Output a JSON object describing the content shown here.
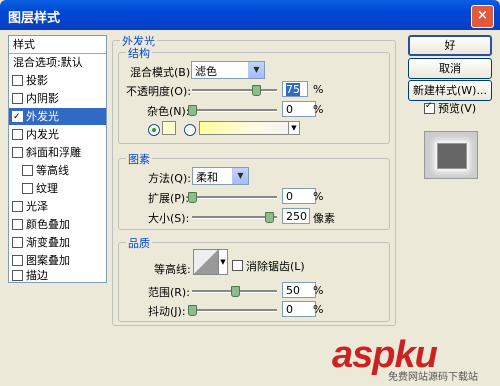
{
  "window": {
    "title": "图层样式",
    "close_label": "×"
  },
  "left_panel": {
    "header": "样式",
    "items": [
      {
        "label": "混合选项:默认",
        "checkbox": false,
        "checked": false,
        "selected": false
      },
      {
        "label": "投影",
        "checkbox": true,
        "checked": false,
        "selected": false
      },
      {
        "label": "内阴影",
        "checkbox": true,
        "checked": false,
        "selected": false
      },
      {
        "label": "外发光",
        "checkbox": true,
        "checked": true,
        "selected": true
      },
      {
        "label": "内发光",
        "checkbox": true,
        "checked": false,
        "selected": false
      },
      {
        "label": "斜面和浮雕",
        "checkbox": true,
        "checked": false,
        "selected": false
      },
      {
        "label": "等高线",
        "checkbox": true,
        "checked": false,
        "selected": false,
        "indent": true
      },
      {
        "label": "纹理",
        "checkbox": true,
        "checked": false,
        "selected": false,
        "indent": true
      },
      {
        "label": "光泽",
        "checkbox": true,
        "checked": false,
        "selected": false
      },
      {
        "label": "颜色叠加",
        "checkbox": true,
        "checked": false,
        "selected": false
      },
      {
        "label": "渐变叠加",
        "checkbox": true,
        "checked": false,
        "selected": false
      },
      {
        "label": "图案叠加",
        "checkbox": true,
        "checked": false,
        "selected": false
      },
      {
        "label": "描边",
        "checkbox": true,
        "checked": false,
        "selected": false
      }
    ]
  },
  "outer_glow": {
    "title": "外发光",
    "structure": {
      "title": "结构",
      "blend_mode_label": "混合模式(B):",
      "blend_mode_value": "滤色",
      "opacity_label": "不透明度(O):",
      "opacity_value": "75",
      "opacity_unit": "%",
      "opacity_level": 0.75,
      "noise_label": "杂色(N):",
      "noise_value": "0",
      "noise_unit": "%",
      "noise_level": 0
    },
    "elements": {
      "title": "图素",
      "technique_label": "方法(Q):",
      "technique_value": "柔和",
      "spread_label": "扩展(P):",
      "spread_value": "0",
      "spread_unit": "%",
      "spread_level": 0,
      "size_label": "大小(S):",
      "size_value": "250",
      "size_unit": "像素",
      "size_level": 0.9
    },
    "quality": {
      "title": "品质",
      "contour_label": "等高线:",
      "antialias_label": "消除锯齿(L)",
      "range_label": "范围(R):",
      "range_value": "50",
      "range_unit": "%",
      "range_level": 0.5,
      "jitter_label": "抖动(J):",
      "jitter_value": "0",
      "jitter_unit": "%",
      "jitter_level": 0
    }
  },
  "buttons": {
    "ok": "好",
    "cancel": "取消",
    "new_style": "新建样式(W)...",
    "preview": "预览(V)"
  },
  "watermark": {
    "main": "aspku",
    "sub": "免费网站源码下载站"
  },
  "colors": {
    "glow": "#ffffcc",
    "selection": "#316ac5",
    "group_title": "#0046d5"
  }
}
